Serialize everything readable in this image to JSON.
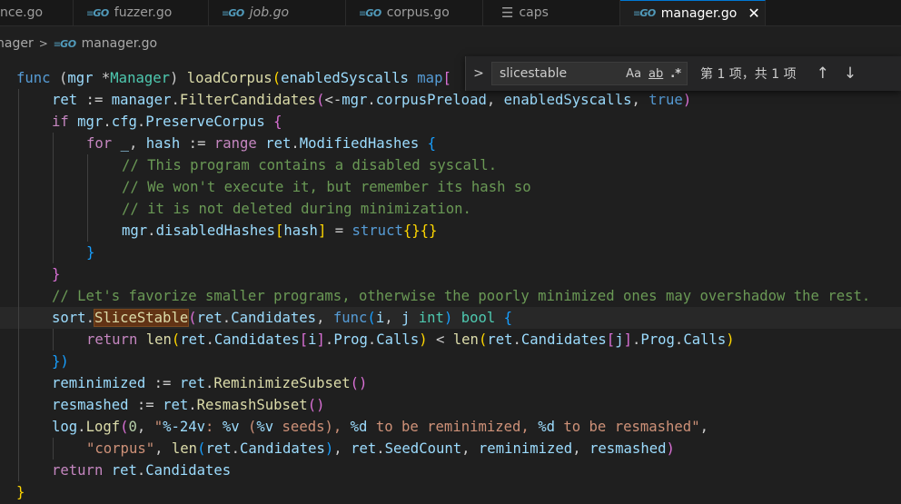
{
  "tabs": [
    {
      "label": "nce.go",
      "icon": "go-file-icon",
      "active": false,
      "italic": false
    },
    {
      "label": "fuzzer.go",
      "icon": "go-file-icon",
      "active": false,
      "italic": false
    },
    {
      "label": "job.go",
      "icon": "go-file-icon",
      "active": false,
      "italic": true
    },
    {
      "label": "corpus.go",
      "icon": "go-file-icon",
      "active": false,
      "italic": false
    },
    {
      "label": "caps",
      "icon": "lines-file-icon",
      "active": false,
      "italic": false
    },
    {
      "label": "manager.go",
      "icon": "go-file-icon",
      "active": true,
      "italic": false
    }
  ],
  "tab_icon_text": "GO",
  "close_glyph": "✕",
  "breadcrumb": {
    "folder": "nager",
    "separator": ">",
    "file": "manager.go"
  },
  "find": {
    "toggle_glyph": ">",
    "query": "slicestable",
    "opt_case": "Aa",
    "opt_word": "ab",
    "opt_regex": ".*",
    "count": "第 1 项，共 1 项",
    "up_glyph": "↑",
    "down_glyph": "↓"
  },
  "code": {
    "l1": {
      "t1": "func",
      "t2": " (",
      "t3": "mgr",
      "t4": " *",
      "t5": "Manager",
      "t6": ") ",
      "t7": "loadCorpus",
      "t8": "(",
      "t9": "enabledSyscalls",
      "t10": " ",
      "t11": "map",
      "t12": "["
    },
    "l2": {
      "t1": "ret",
      "t2": " := ",
      "t3": "manager",
      "t4": ".",
      "t5": "FilterCandidates",
      "t6": "(",
      "t7": "<-",
      "t8": "mgr",
      "t9": ".",
      "t10": "corpusPreload",
      "t11": ", ",
      "t12": "enabledSyscalls",
      "t13": ", ",
      "t14": "true",
      "t15": ")"
    },
    "l3": {
      "t1": "if",
      "t2": " ",
      "t3": "mgr",
      "t4": ".",
      "t5": "cfg",
      "t6": ".",
      "t7": "PreserveCorpus",
      "t8": " ",
      "t9": "{"
    },
    "l4": {
      "t1": "for",
      "t2": " ",
      "t3": "_",
      "t4": ", ",
      "t5": "hash",
      "t6": " := ",
      "t7": "range",
      "t8": " ",
      "t9": "ret",
      "t10": ".",
      "t11": "ModifiedHashes",
      "t12": " ",
      "t13": "{"
    },
    "l5": {
      "t1": "// This program contains a disabled syscall."
    },
    "l6": {
      "t1": "// We won't execute it, but remember its hash so"
    },
    "l7": {
      "t1": "// it is not deleted during minimization."
    },
    "l8": {
      "t1": "mgr",
      "t2": ".",
      "t3": "disabledHashes",
      "t4": "[",
      "t5": "hash",
      "t6": "]",
      "t7": " = ",
      "t8": "struct",
      "t9": "{}",
      "t10": "{}"
    },
    "l9": {
      "t1": "}"
    },
    "l10": {
      "t1": "}"
    },
    "l11": {
      "t1": "// Let's favorize smaller programs, otherwise the poorly minimized ones may overshadow the rest."
    },
    "l12": {
      "t1": "sort",
      "t2": ".",
      "t3": "SliceStable",
      "t4": "(",
      "t5": "ret",
      "t6": ".",
      "t7": "Candidates",
      "t8": ", ",
      "t9": "func",
      "t10": "(",
      "t11": "i",
      "t12": ", ",
      "t13": "j",
      "t14": " ",
      "t15": "int",
      "t16": ") ",
      "t17": "bool",
      "t18": " ",
      "t19": "{"
    },
    "l13": {
      "t1": "return",
      "t2": " ",
      "t3": "len",
      "t4": "(",
      "t5": "ret",
      "t6": ".",
      "t7": "Candidates",
      "t8": "[",
      "t9": "i",
      "t10": "]",
      "t11": ".",
      "t12": "Prog",
      "t13": ".",
      "t14": "Calls",
      "t15": ")",
      "t16": " < ",
      "t17": "len",
      "t18": "(",
      "t19": "ret",
      "t20": ".",
      "t21": "Candidates",
      "t22": "[",
      "t23": "j",
      "t24": "]",
      "t25": ".",
      "t26": "Prog",
      "t27": ".",
      "t28": "Calls",
      "t29": ")"
    },
    "l14": {
      "t1": "})"
    },
    "l15": {
      "t1": "reminimized",
      "t2": " := ",
      "t3": "ret",
      "t4": ".",
      "t5": "ReminimizeSubset",
      "t6": "()"
    },
    "l16": {
      "t1": "resmashed",
      "t2": " := ",
      "t3": "ret",
      "t4": ".",
      "t5": "ResmashSubset",
      "t6": "()"
    },
    "l17": {
      "t1": "log",
      "t2": ".",
      "t3": "Logf",
      "t4": "(",
      "t5": "0",
      "t6": ", ",
      "t7": "\"",
      "t8": "%-24v",
      "t9": ": ",
      "t10": "%v",
      "t11": " (",
      "t12": "%v",
      "t13": " seeds), ",
      "t14": "%d",
      "t15": " to be reminimized, ",
      "t16": "%d",
      "t17": " to be resmashed\"",
      "t18": ","
    },
    "l18": {
      "t1": "\"corpus\"",
      "t2": ", ",
      "t3": "len",
      "t4": "(",
      "t5": "ret",
      "t6": ".",
      "t7": "Candidates",
      "t8": ")",
      "t9": ", ",
      "t10": "ret",
      "t11": ".",
      "t12": "SeedCount",
      "t13": ", ",
      "t14": "reminimized",
      "t15": ", ",
      "t16": "resmashed",
      "t17": ")"
    },
    "l19": {
      "t1": "return",
      "t2": " ",
      "t3": "ret",
      "t4": ".",
      "t5": "Candidates"
    },
    "l20": {
      "t1": "}"
    }
  },
  "colors": {
    "background": "#1f1f1f",
    "tabbar": "#181818",
    "accent": "#0078d4",
    "match_highlight": "#623315",
    "keyword": "#569cd6",
    "control": "#c586c0",
    "function": "#dcdcaa",
    "variable": "#9cdcfe",
    "type": "#4ec9b0",
    "comment": "#6a9955",
    "string": "#ce9178"
  }
}
